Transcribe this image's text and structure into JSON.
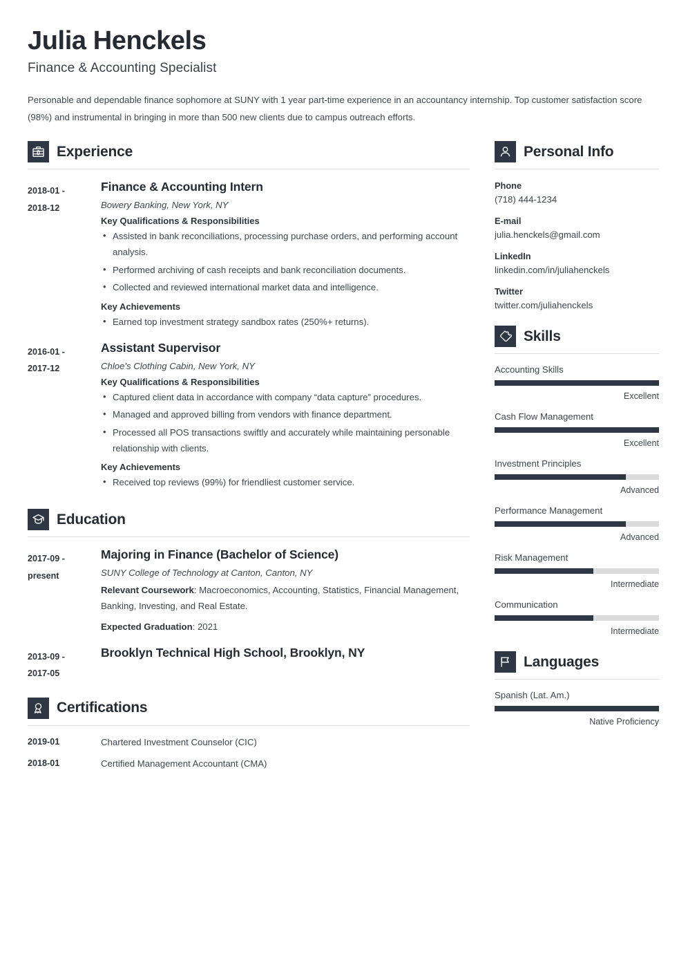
{
  "header": {
    "full_name": "Julia Henckels",
    "job_title": "Finance & Accounting Specialist",
    "summary": "Personable and dependable finance sophomore at SUNY with 1 year part-time experience in an accountancy internship. Top customer satisfaction score (98%) and instrumental in bringing in more than 500 new clients due to campus outreach efforts."
  },
  "theme": {
    "accent_dark": "#2e3744",
    "rule": "#dcdedf",
    "bar_track": "#dcdcdc",
    "text": "#3f454d"
  },
  "sections": {
    "experience": {
      "title": "Experience",
      "icon": "briefcase-icon"
    },
    "education": {
      "title": "Education",
      "icon": "graduation-cap-icon"
    },
    "certifications": {
      "title": "Certifications",
      "icon": "award-ribbon-icon"
    },
    "personal_info": {
      "title": "Personal Info",
      "icon": "person-icon"
    },
    "skills": {
      "title": "Skills",
      "icon": "puzzle-piece-icon"
    },
    "languages": {
      "title": "Languages",
      "icon": "flag-icon"
    }
  },
  "experience": [
    {
      "date": "2018-01 - 2018-12",
      "date_line1": "2018-01 -",
      "date_line2": "2018-12",
      "title": "Finance & Accounting Intern",
      "employer": "Bowery Banking, New York, NY",
      "responsibilities_label": "Key Qualifications & Responsibilities",
      "responsibilities": [
        "Assisted in bank reconciliations, processing purchase orders, and performing account analysis.",
        "Performed archiving of cash receipts and bank reconciliation documents.",
        "Collected and reviewed international market data and intelligence."
      ],
      "achievements_label": "Key Achievements",
      "achievements": [
        "Earned top investment strategy sandbox rates (250%+ returns)."
      ]
    },
    {
      "date": "2016-01 - 2017-12",
      "date_line1": "2016-01 -",
      "date_line2": "2017-12",
      "title": "Assistant Supervisor",
      "employer": "Chloe's Clothing Cabin, New York, NY",
      "responsibilities_label": "Key Qualifications & Responsibilities",
      "responsibilities": [
        "Captured client data in accordance with company “data capture” procedures.",
        "Managed and approved billing from vendors with finance department.",
        "Processed all POS transactions swiftly and accurately while maintaining personable relationship with clients."
      ],
      "achievements_label": "Key Achievements",
      "achievements": [
        "Received top reviews (99%) for friendliest customer service."
      ]
    }
  ],
  "education": [
    {
      "date_line1": "2017-09 -",
      "date_line2": "present",
      "title": "Majoring in Finance (Bachelor of Science)",
      "school": "SUNY College of Technology at Canton, Canton, NY",
      "coursework_label": "Relevant Coursework",
      "coursework_value": ": Macroeconomics, Accounting, Statistics, Financial Management, Banking, Investing, and Real Estate.",
      "graduation_label": "Expected Graduation",
      "graduation_value": ": 2021"
    },
    {
      "date_line1": "2013-09 -",
      "date_line2": "2017-05",
      "title": "Brooklyn Technical High School, Brooklyn, NY",
      "school": "",
      "coursework_label": "",
      "coursework_value": "",
      "graduation_label": "",
      "graduation_value": ""
    }
  ],
  "certifications": [
    {
      "date": "2019-01",
      "name": "Chartered Investment Counselor (CIC)"
    },
    {
      "date": "2018-01",
      "name": "Certified Management Accountant (CMA)"
    }
  ],
  "personal_info": [
    {
      "label": "Phone",
      "value": "(718) 444-1234"
    },
    {
      "label": "E-mail",
      "value": "julia.henckels@gmail.com"
    },
    {
      "label": "LinkedIn",
      "value": "linkedin.com/in/juliahenckels"
    },
    {
      "label": "Twitter",
      "value": "twitter.com/juliahenckels"
    }
  ],
  "skills": [
    {
      "name": "Accounting Skills",
      "level": "Excellent",
      "percent": 100
    },
    {
      "name": "Cash Flow Management",
      "level": "Excellent",
      "percent": 100
    },
    {
      "name": "Investment Principles",
      "level": "Advanced",
      "percent": 80
    },
    {
      "name": "Performance Management",
      "level": "Advanced",
      "percent": 80
    },
    {
      "name": "Risk Management",
      "level": "Intermediate",
      "percent": 60
    },
    {
      "name": "Communication",
      "level": "Intermediate",
      "percent": 60
    }
  ],
  "languages": [
    {
      "name": "Spanish (Lat. Am.)",
      "level": "Native Proficiency",
      "percent": 100
    }
  ]
}
